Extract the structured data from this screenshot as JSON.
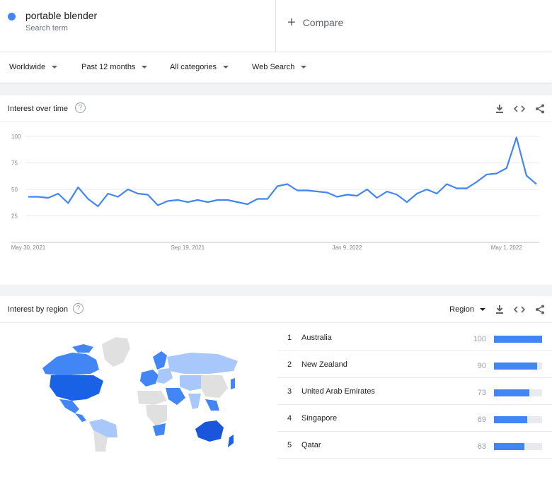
{
  "search": {
    "term": "portable blender",
    "term_type": "Search term",
    "compare_label": "Compare",
    "term_color": "#4285f4"
  },
  "filters": {
    "location": "Worldwide",
    "time_range": "Past 12 months",
    "category": "All categories",
    "property": "Web Search"
  },
  "interest_over_time": {
    "title": "Interest over time",
    "actions": [
      "download-icon",
      "embed-icon",
      "share-icon"
    ]
  },
  "chart_data": {
    "type": "line",
    "x_tick_labels": [
      "May 30, 2021",
      "Sep 19, 2021",
      "Jan 9, 2022",
      "May 1, 2022"
    ],
    "y_tick_labels": [
      "100",
      "75",
      "50",
      "25"
    ],
    "y_ticks": [
      100,
      75,
      50,
      25
    ],
    "ylim": [
      0,
      100
    ],
    "grid": true,
    "line_color": "#4285f4",
    "series": [
      {
        "values": [
          43,
          43,
          42,
          46,
          37,
          52,
          41,
          34,
          46,
          43,
          50,
          46,
          45,
          35,
          39,
          40,
          38,
          40,
          38,
          40,
          40,
          38,
          36,
          41,
          41,
          53,
          55,
          49,
          49,
          48,
          47,
          43,
          45,
          44,
          50,
          42,
          48,
          45,
          38,
          46,
          50,
          46,
          55,
          51,
          51,
          57,
          64,
          65,
          70,
          99,
          63,
          55
        ]
      }
    ]
  },
  "interest_by_region": {
    "title": "Interest by region",
    "resolution_label": "Region",
    "actions": [
      "download-icon",
      "embed-icon",
      "share-icon"
    ],
    "regions": [
      {
        "rank": "1",
        "name": "Australia",
        "value": 100
      },
      {
        "rank": "2",
        "name": "New Zealand",
        "value": 90
      },
      {
        "rank": "3",
        "name": "United Arab Emirates",
        "value": 73
      },
      {
        "rank": "4",
        "name": "Singapore",
        "value": 69
      },
      {
        "rank": "5",
        "name": "Qatar",
        "value": 63
      }
    ]
  }
}
